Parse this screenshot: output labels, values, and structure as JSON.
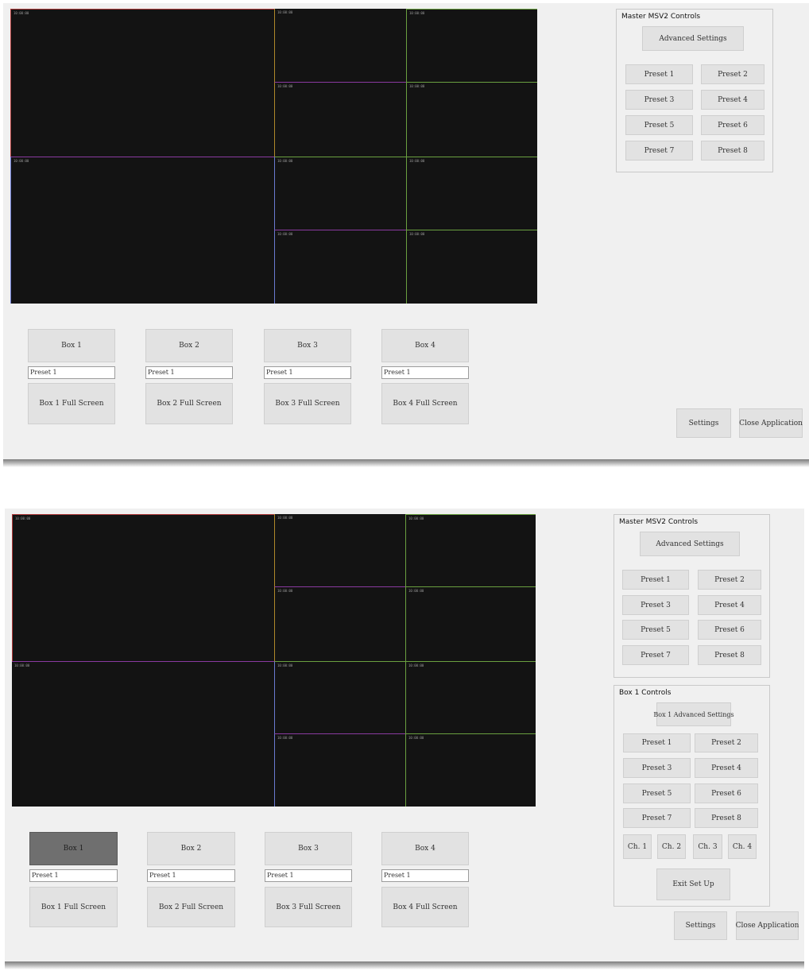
{
  "screen1": {
    "video_timestamps": [
      "10:00:00",
      "10:00:00",
      "10:00:00",
      "10:00:00",
      "10:00:00",
      "10:00:00",
      "10:00:00",
      "10:00:00",
      "10:00:00",
      "10:00:00"
    ],
    "boxes": [
      {
        "label": "Box 1",
        "preset": "Preset 1",
        "fullscreen": "Box 1 Full Screen"
      },
      {
        "label": "Box 2",
        "preset": "Preset 1",
        "fullscreen": "Box 2 Full Screen"
      },
      {
        "label": "Box 3",
        "preset": "Preset 1",
        "fullscreen": "Box 3 Full Screen"
      },
      {
        "label": "Box 4",
        "preset": "Preset 1",
        "fullscreen": "Box 4 Full Screen"
      }
    ],
    "master": {
      "title": "Master MSV2 Controls",
      "advanced": "Advanced Settings",
      "presets": [
        "Preset 1",
        "Preset 2",
        "Preset 3",
        "Preset 4",
        "Preset 5",
        "Preset 6",
        "Preset 7",
        "Preset 8"
      ]
    },
    "settings": "Settings",
    "close": "Close Application"
  },
  "screen2": {
    "video_timestamps": [
      "10:00:00",
      "10:00:00",
      "10:00:00",
      "10:00:00",
      "10:00:00",
      "10:00:00",
      "10:00:00",
      "10:00:00",
      "10:00:00",
      "10:00:00"
    ],
    "boxes": [
      {
        "label": "Box 1",
        "preset": "Preset 1",
        "fullscreen": "Box 1 Full Screen",
        "selected": true
      },
      {
        "label": "Box 2",
        "preset": "Preset 1",
        "fullscreen": "Box 2 Full Screen"
      },
      {
        "label": "Box 3",
        "preset": "Preset 1",
        "fullscreen": "Box 3 Full Screen"
      },
      {
        "label": "Box 4",
        "preset": "Preset 1",
        "fullscreen": "Box 4 Full Screen"
      }
    ],
    "master": {
      "title": "Master MSV2 Controls",
      "advanced": "Advanced Settings",
      "presets": [
        "Preset 1",
        "Preset 2",
        "Preset 3",
        "Preset 4",
        "Preset 5",
        "Preset 6",
        "Preset 7",
        "Preset 8"
      ]
    },
    "box_controls": {
      "title": "Box 1 Controls",
      "advanced": "Box 1 Advanced Settings",
      "presets": [
        "Preset 1",
        "Preset 2",
        "Preset 3",
        "Preset 4",
        "Preset 5",
        "Preset 6",
        "Preset 7",
        "Preset 8"
      ],
      "channels": [
        "Ch. 1",
        "Ch. 2",
        "Ch. 3",
        "Ch. 4"
      ],
      "exit": "Exit Set Up"
    },
    "settings": "Settings",
    "close": "Close Application"
  },
  "colors": {
    "window_bg": "#f0f0f0",
    "video_bg": "#131313",
    "button_bg": "#e2e2e2",
    "selected_button_bg": "#6f6f6f",
    "divider_red": "#b03a3a",
    "divider_purple": "#8a3aa0",
    "divider_orange": "#b0882a",
    "divider_green": "#6aa040",
    "divider_blue": "#6a7ad0"
  }
}
